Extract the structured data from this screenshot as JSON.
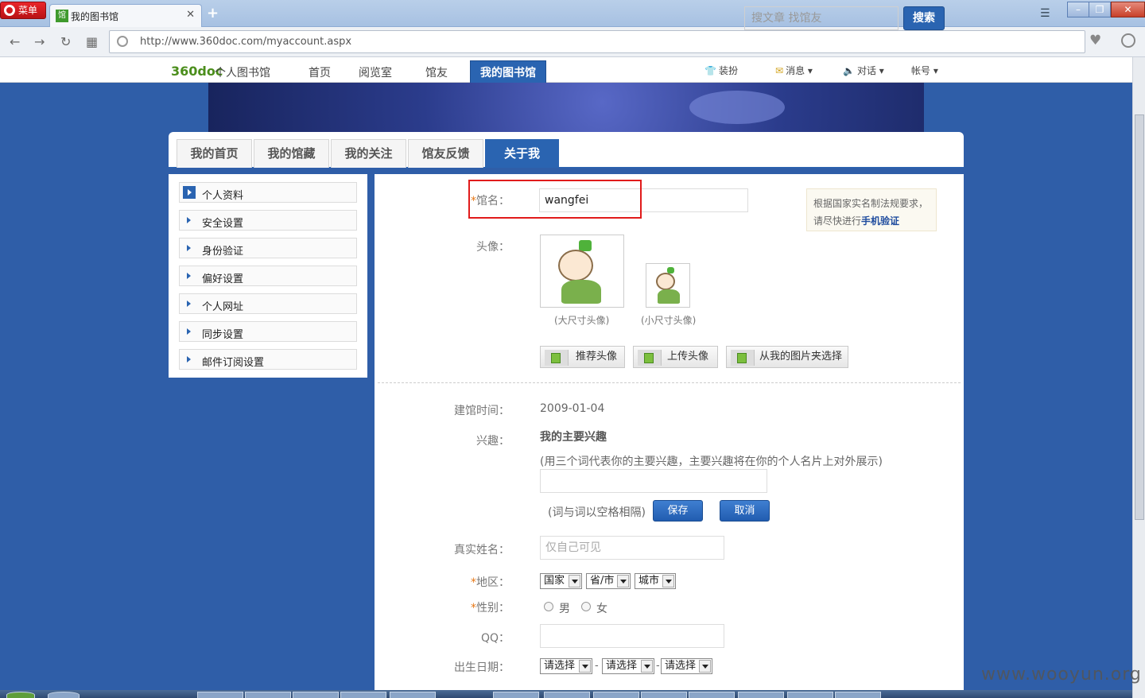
{
  "browser": {
    "menu_label": "菜单",
    "tab_title": "我的图书馆",
    "favicon_text": "馆",
    "url": "http://www.360doc.com/myaccount.aspx"
  },
  "site": {
    "logo": "360doc",
    "logo_sub": "个人图书馆",
    "nav": [
      "首页",
      "阅览室",
      "馆友",
      "我的图书馆"
    ],
    "tools": [
      "装扮",
      "消息",
      "对话",
      "帐号"
    ]
  },
  "card_tabs": [
    "我的首页",
    "我的馆藏",
    "我的关注",
    "馆友反馈",
    "关于我"
  ],
  "search": {
    "placeholder": "搜文章 找馆友",
    "button": "搜索"
  },
  "sidebar": {
    "items": [
      {
        "label": "个人资料"
      },
      {
        "label": "安全设置"
      },
      {
        "label": "身份验证"
      },
      {
        "label": "偏好设置"
      },
      {
        "label": "个人网址"
      },
      {
        "label": "同步设置"
      },
      {
        "label": "邮件订阅设置"
      }
    ]
  },
  "form": {
    "req_mark": "*",
    "library_name_label": "馆名：",
    "library_name_value": "wangfei",
    "tip_text": "根据国家实名制法规要求，请尽快进行",
    "tip_link": "手机验证",
    "avatar_label": "头像：",
    "avatar_large_caption": "(大尺寸头像)",
    "avatar_small_caption": "(小尺寸头像)",
    "btn_recommend": "推荐头像",
    "btn_upload": "上传头像",
    "btn_from_album": "从我的图片夹选择",
    "created_label": "建馆时间：",
    "created_value": "2009-01-04",
    "interest_label": "兴趣：",
    "interest_title": "我的主要兴趣",
    "interest_hint": "(用三个词代表你的主要兴趣，主要兴趣将在你的个人名片上对外展示)",
    "interest_sep_hint": "(词与词以空格相隔)",
    "save": "保存",
    "cancel": "取消",
    "realname_label": "真实姓名：",
    "realname_placeholder": "仅自己可见",
    "region_label": "地区：",
    "region_country": "国家",
    "region_province": "省/市",
    "region_city": "城市",
    "gender_label": "性别：",
    "gender_male": "男",
    "gender_female": "女",
    "qq_label": "QQ：",
    "birth_label": "出生日期：",
    "birth_select": "请选择",
    "dash": "-"
  },
  "watermark": "www.wooyun.org"
}
